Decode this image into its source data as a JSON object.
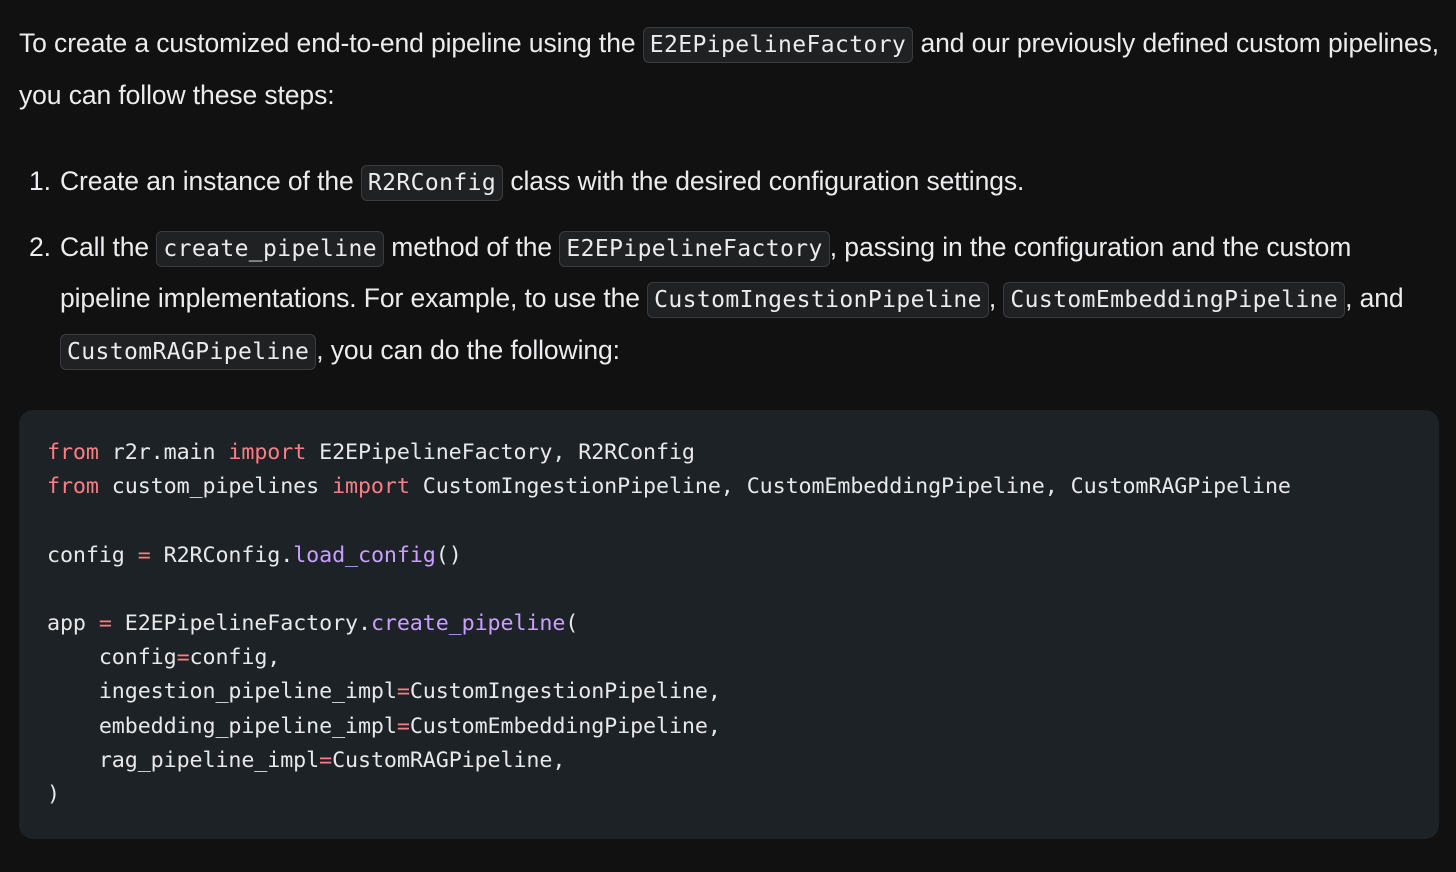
{
  "intro": {
    "text_before": "To create a customized end-to-end pipeline using the ",
    "code_factory": "E2EPipelineFactory",
    "text_after": " and our previously defined custom pipelines, you can follow these steps:"
  },
  "steps": [
    {
      "number": "1.",
      "t1": "Create an instance of the ",
      "c1": "R2RConfig",
      "t2": " class with the desired configuration settings."
    },
    {
      "number": "2.",
      "t1": "Call the ",
      "c1": "create_pipeline",
      "t2": " method of the ",
      "c2": "E2EPipelineFactory",
      "t3": ", passing in the configuration and the custom pipeline implementations. For example, to use the ",
      "c3": "CustomIngestionPipeline",
      "t4": ", ",
      "c4": "CustomEmbeddingPipeline",
      "t5": ", and ",
      "c5": "CustomRAGPipeline",
      "t6": ", you can do the following:"
    }
  ],
  "code": {
    "language": "python",
    "line1": {
      "kw1": "from",
      "mod": " r2r.main ",
      "kw2": "import",
      "names": " E2EPipelineFactory, R2RConfig"
    },
    "line2": {
      "kw1": "from",
      "mod": " custom_pipelines ",
      "kw2": "import",
      "names": " CustomIngestionPipeline, CustomEmbeddingPipeline, CustomRAGPipeline"
    },
    "line4": {
      "var": "config ",
      "op": "=",
      "obj": " R2RConfig.",
      "fn": "load_config",
      "tail": "()"
    },
    "line6": {
      "var": "app ",
      "op": "=",
      "obj": " E2EPipelineFactory.",
      "fn": "create_pipeline",
      "tail": "("
    },
    "line7": {
      "name": "    config",
      "op": "=",
      "value": "config,"
    },
    "line8": {
      "name": "    ingestion_pipeline_impl",
      "op": "=",
      "value": "CustomIngestionPipeline,"
    },
    "line9": {
      "name": "    embedding_pipeline_impl",
      "op": "=",
      "value": "CustomEmbeddingPipeline,"
    },
    "line10": {
      "name": "    rag_pipeline_impl",
      "op": "=",
      "value": "CustomRAGPipeline,"
    },
    "line11": ")"
  },
  "colors": {
    "background": "#111112",
    "text": "#ececee",
    "code_background": "#1d2226",
    "keyword": "#fd7d85",
    "function": "#c9a0ff"
  }
}
